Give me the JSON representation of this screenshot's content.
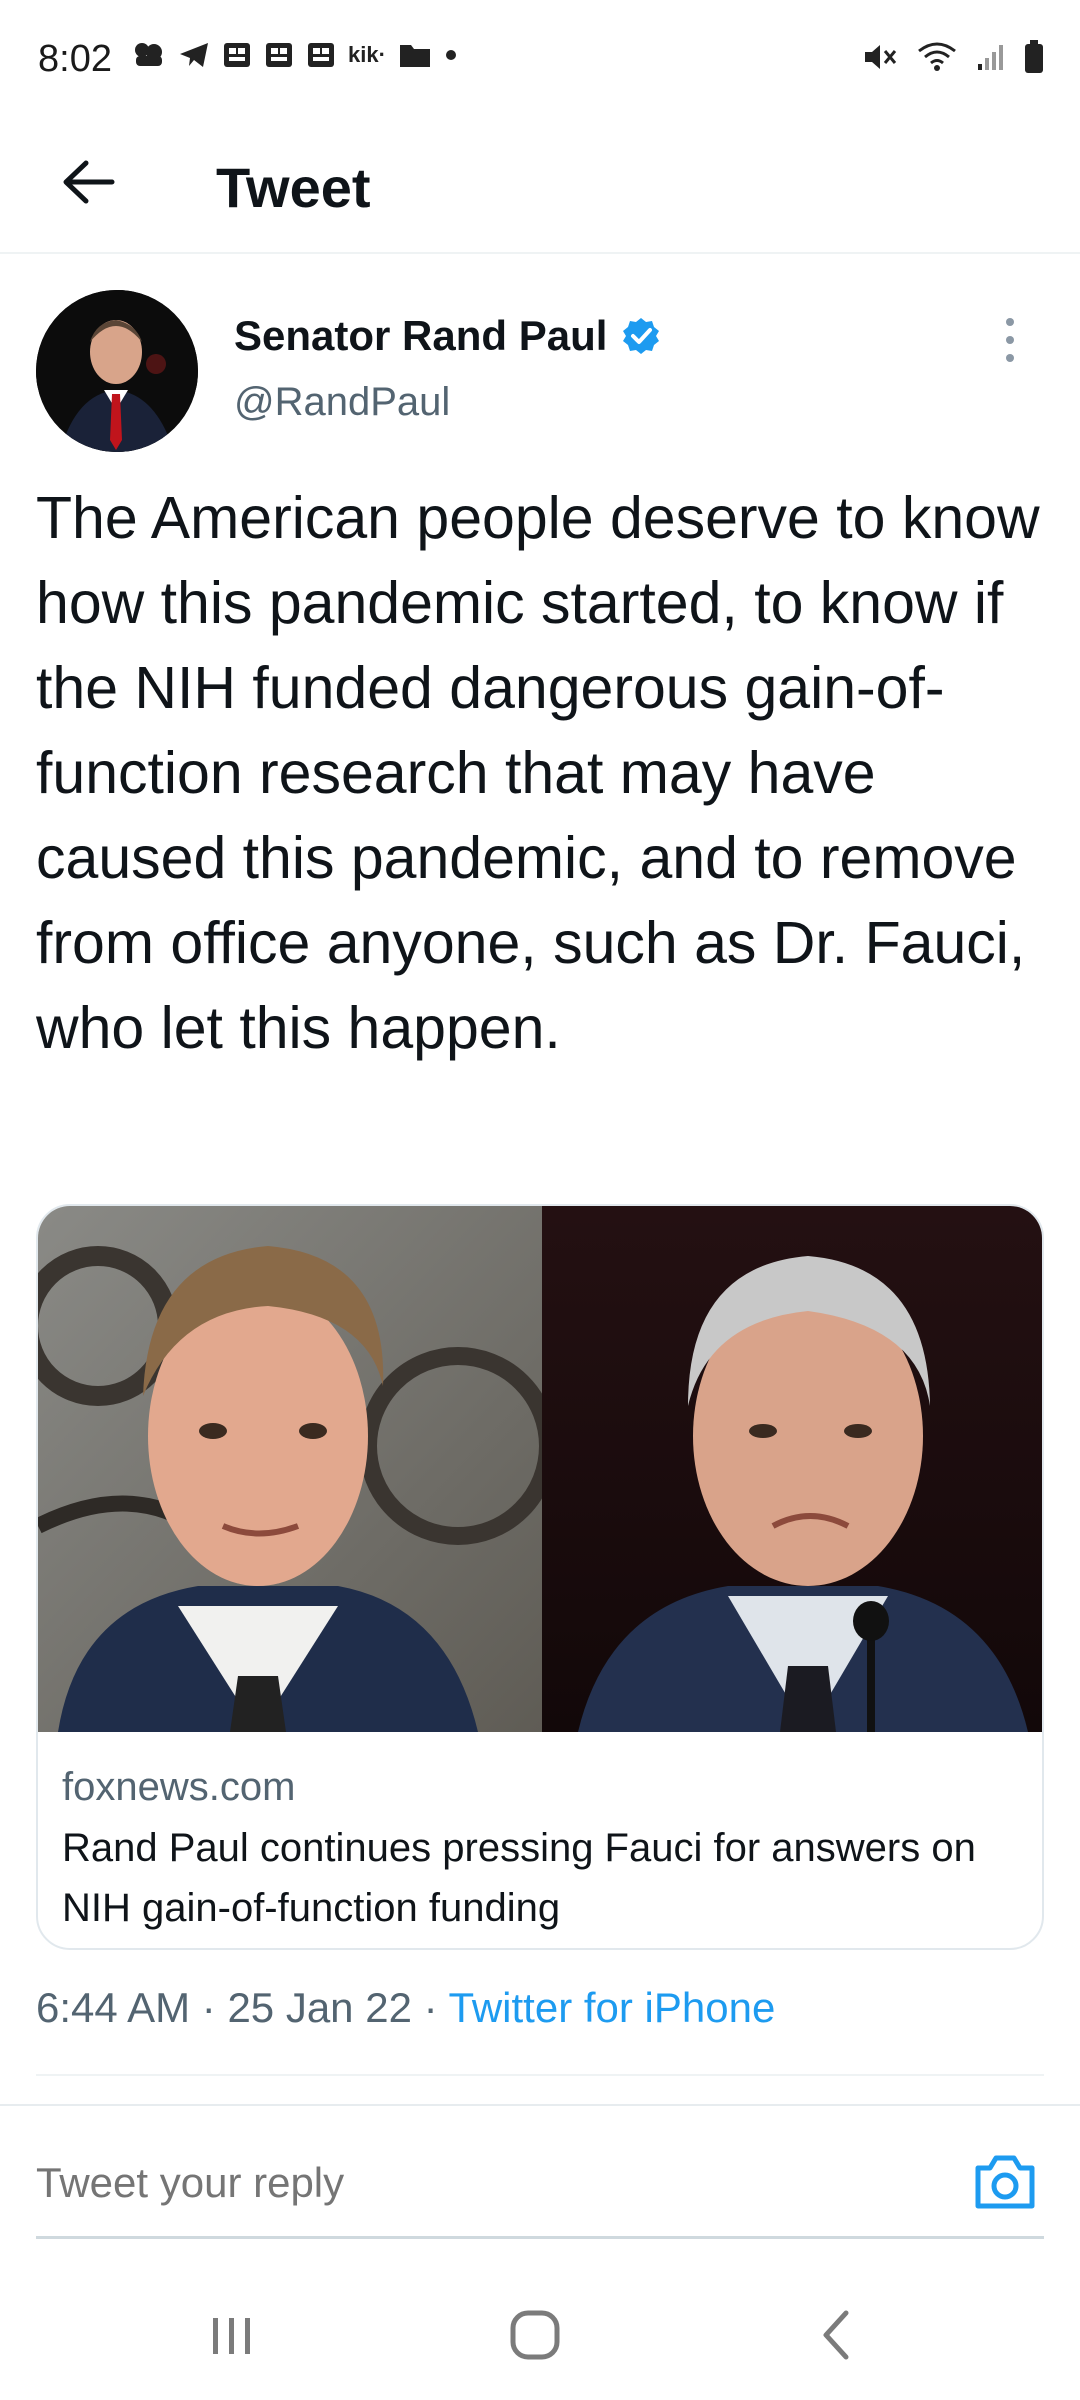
{
  "status_bar": {
    "time": "8:02",
    "notification_icons": [
      "community-icon",
      "telegram-icon",
      "news-icon",
      "news-icon",
      "news-icon",
      "kik-icon",
      "folder-icon",
      "dot-icon"
    ],
    "kik_label": "kik·",
    "system_icons": [
      "mute-icon",
      "wifi-icon",
      "signal-icon",
      "battery-icon"
    ]
  },
  "app_bar": {
    "title": "Tweet",
    "back_icon": "arrow-left-icon"
  },
  "tweet": {
    "author_name": "Senator Rand Paul",
    "author_handle": "@RandPaul",
    "verified": true,
    "text": "The American people deserve to know how this pandemic started, to know if the NIH funded dangerous gain-of-function research that may have caused this pandemic, and to remove from office anyone, such as Dr. Fauci, who let this happen.",
    "card": {
      "domain": "foxnews.com",
      "title": "Rand Paul continues pressing Fauci for answers on NIH gain-of-function funding"
    },
    "time": "6:44 AM",
    "separator": " · ",
    "date": "25 Jan 22",
    "source": "Twitter for iPhone"
  },
  "reply": {
    "placeholder": "Tweet your reply"
  },
  "colors": {
    "accent": "#1d9bf0",
    "text": "#0f1419",
    "secondary_text": "#536471",
    "border": "#e1e8ed"
  }
}
